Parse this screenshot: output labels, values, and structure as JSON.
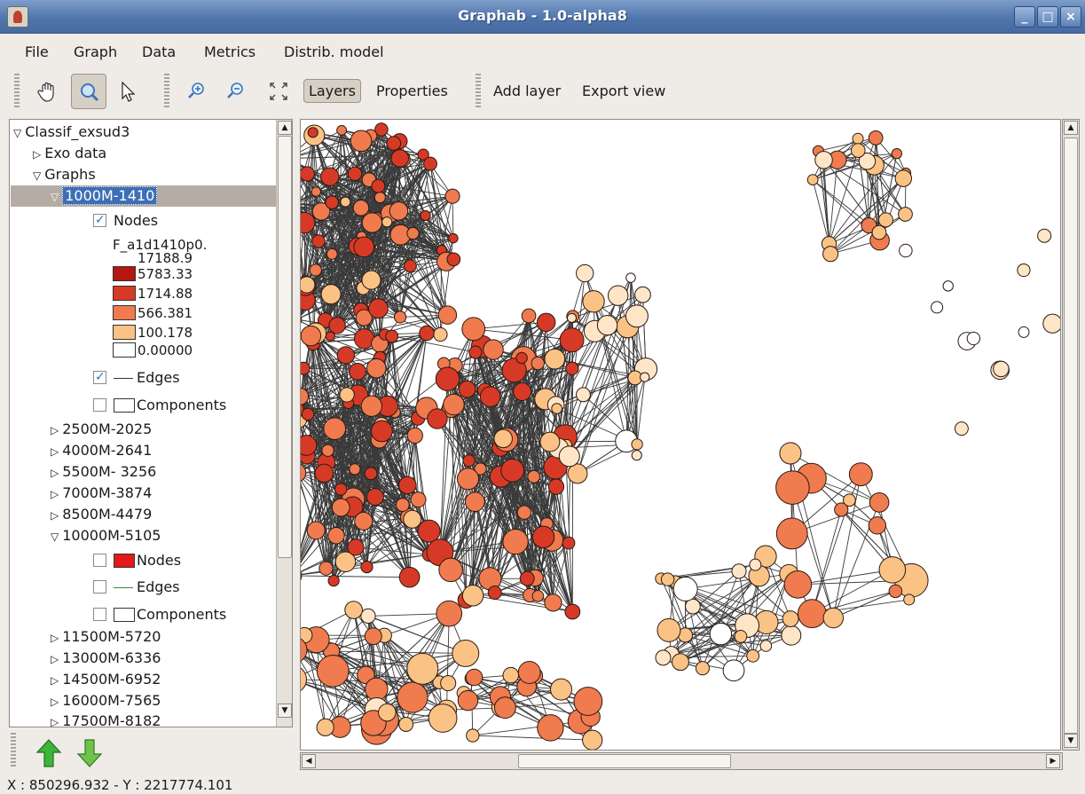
{
  "window": {
    "title": "Graphab - 1.0-alpha8"
  },
  "menu": [
    "File",
    "Graph",
    "Data",
    "Metrics",
    "Distrib. model"
  ],
  "toolbar": {
    "layers_label": "Layers",
    "properties_label": "Properties",
    "add_layer_label": "Add layer",
    "export_view_label": "Export view"
  },
  "tree": {
    "root": "Classif_exsud3",
    "exo_data": "Exo data",
    "graphs": "Graphs",
    "selected_graph": "1000M-1410",
    "nodes_label": "Nodes",
    "legend_title": "F_a1d1410p0.",
    "legend": [
      {
        "label": "17188.9",
        "color": "#b3170f"
      },
      {
        "label": "5783.33",
        "color": "#d63a26"
      },
      {
        "label": "1714.88",
        "color": "#ef7b4f"
      },
      {
        "label": "566.381",
        "color": "#fbc285"
      },
      {
        "label": "100.178",
        "color": "#fee5c8"
      },
      {
        "label": "0.00000",
        "color": "#ffffff"
      }
    ],
    "edges_label": "Edges",
    "components_label": "Components",
    "graph_list_a": [
      "2500M-2025",
      "4000M-2641",
      "5500M- 3256",
      "7000M-3874",
      "8500M-4479"
    ],
    "expanded_graph": "10000M-5105",
    "sub_nodes_label": "Nodes",
    "sub_edges_label": "Edges",
    "sub_components_label": "Components",
    "graph_list_b": [
      "11500M-5720",
      "13000M-6336",
      "14500M-6952",
      "16000M-7565",
      "17500M-8182"
    ]
  },
  "status": {
    "coords": "X : 850296.932 - Y : 2217774.101"
  },
  "colors": {
    "edge": "#3a3a3a",
    "node_stroke": "#2a1a12",
    "selection": "#3d6fb6",
    "edges_line_10000": "#2e8b3e",
    "nodes_swatch_10000": "#e21a1a"
  }
}
